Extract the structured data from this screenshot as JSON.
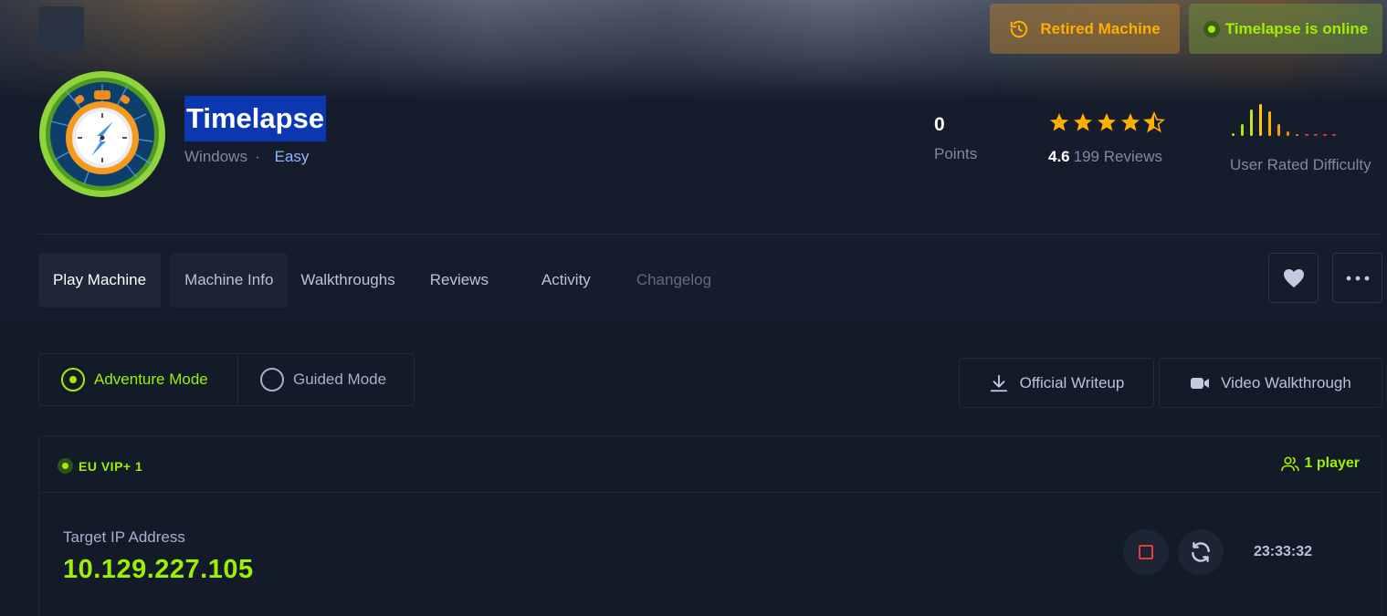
{
  "header": {
    "retired_label": "Retired Machine",
    "online_label": "Timelapse is online"
  },
  "machine": {
    "name": "Timelapse",
    "os": "Windows",
    "separator": "·",
    "difficulty": "Easy"
  },
  "stats": {
    "points_value": "0",
    "points_label": "Points",
    "rating_value": "4.6",
    "rating_stars": 4.6,
    "reviews_label": "199 Reviews",
    "difficulty_label": "User Rated Difficulty"
  },
  "tabs": [
    {
      "label": "Play Machine"
    },
    {
      "label": "Machine Info"
    },
    {
      "label": "Walkthroughs"
    },
    {
      "label": "Reviews"
    },
    {
      "label": "Activity"
    },
    {
      "label": "Changelog"
    }
  ],
  "modes": {
    "adventure": "Adventure Mode",
    "guided": "Guided Mode"
  },
  "actions": {
    "writeup": "Official Writeup",
    "video": "Video Walkthrough"
  },
  "instance": {
    "server": "EU VIP+ 1",
    "players": "1 player",
    "ip_label": "Target IP Address",
    "ip": "10.129.227.105",
    "timer": "23:33:32"
  },
  "colors": {
    "accent_green": "#9fef00",
    "accent_orange": "#ffaf00",
    "background": "#131a28",
    "selection_blue": "#0b38b0",
    "stop_red": "#ff3e3e"
  },
  "icons": {
    "retired": "history-icon",
    "online": "status-dot-icon",
    "favorite": "heart-icon",
    "more": "more-dots-icon",
    "writeup": "download-icon",
    "video": "video-camera-icon",
    "players": "users-icon",
    "stop": "stop-icon",
    "reset": "refresh-icon"
  }
}
